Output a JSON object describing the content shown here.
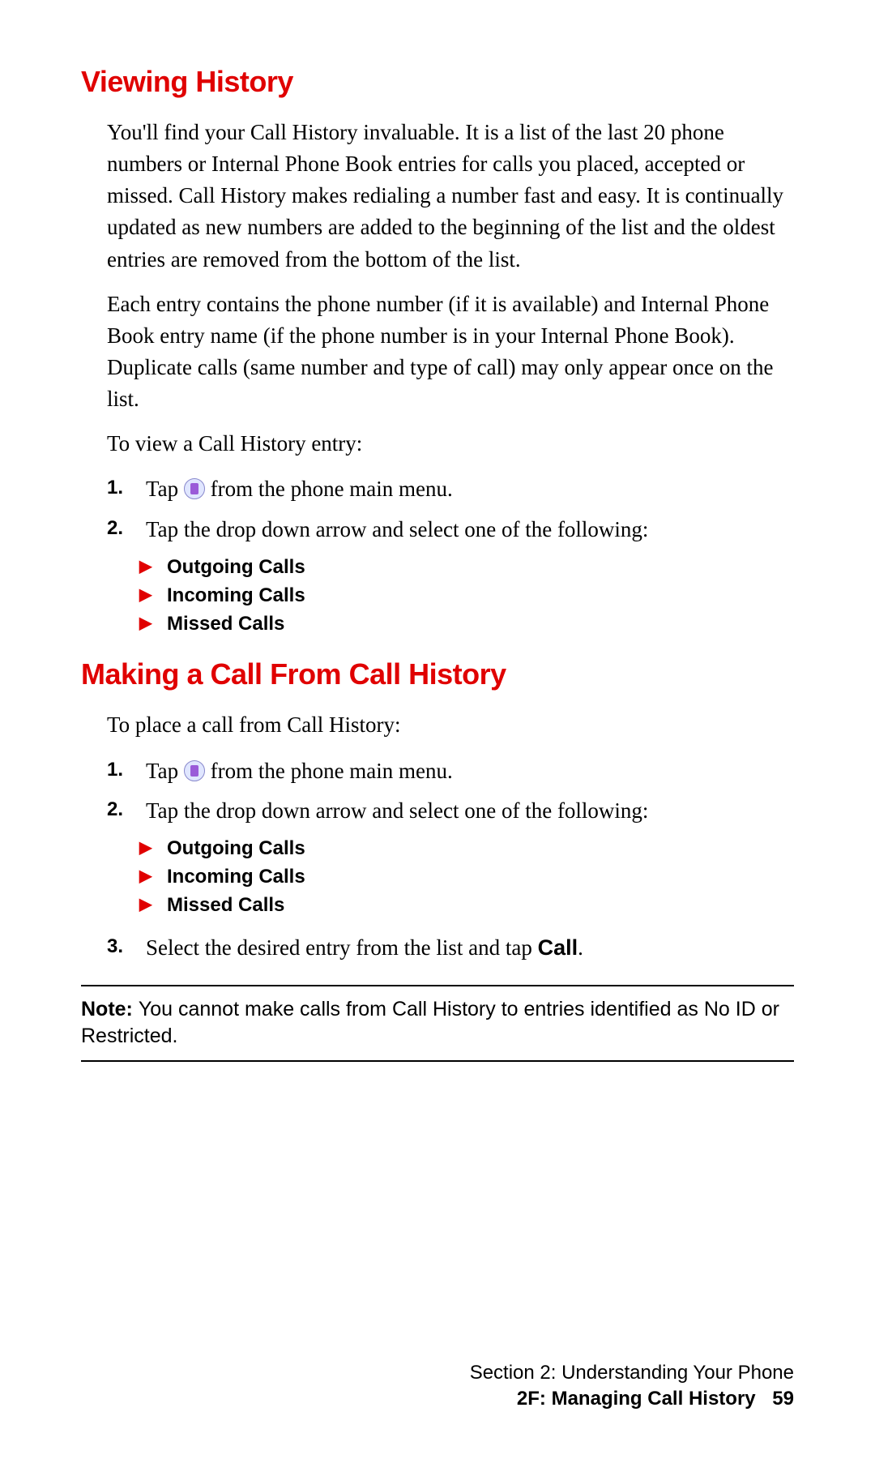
{
  "section1": {
    "heading": "Viewing History",
    "para1": "You'll find your Call History invaluable. It is a list of the last 20 phone numbers or Internal Phone Book entries for calls you placed, accepted or missed. Call History makes redialing a number fast and easy. It is continually updated as new numbers are added to the beginning of the list and the oldest entries are removed from the bottom of the list.",
    "para2": "Each entry contains the phone number (if it is available) and Internal Phone Book entry name (if the phone number is in your Internal Phone Book). Duplicate calls (same number and type of call) may only appear once on the list.",
    "para3": "To view a Call History entry:",
    "steps": [
      {
        "pre": "Tap ",
        "post": " from the phone main menu."
      },
      {
        "text": "Tap the drop down arrow and select one of the following:"
      }
    ],
    "bullets": [
      "Outgoing Calls",
      "Incoming Calls",
      "Missed Calls"
    ]
  },
  "section2": {
    "heading": "Making a Call From Call History",
    "para1": "To place a call from Call History:",
    "steps": [
      {
        "pre": "Tap ",
        "post": " from the phone main menu."
      },
      {
        "text": "Tap the drop down arrow and select one of the following:"
      }
    ],
    "bullets": [
      "Outgoing Calls",
      "Incoming Calls",
      "Missed Calls"
    ],
    "step3_pre": "Select the desired entry from the list and tap ",
    "step3_bold": "Call",
    "step3_post": "."
  },
  "note": {
    "label": "Note: ",
    "text": "You cannot make calls from Call History to entries identified as No ID or Restricted."
  },
  "footer": {
    "section": "Section 2: Understanding Your Phone",
    "subsection": "2F: Managing Call History",
    "page": "59"
  }
}
